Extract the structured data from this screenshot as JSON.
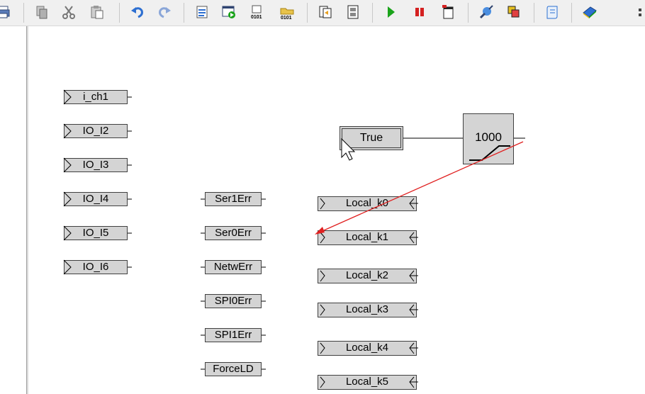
{
  "toolbar": {
    "icons": [
      "print-icon",
      "copy-icon",
      "cut-icon",
      "paste-icon",
      "undo-icon",
      "redo-icon",
      "document-list-icon",
      "window-go-icon",
      "compile-icon",
      "download-icon",
      "export-icon",
      "memory-icon",
      "run-icon",
      "stop-icon",
      "reset-icon",
      "connect-icon",
      "windows-icon",
      "script-icon",
      "book-icon",
      "more-icon"
    ],
    "colors": {
      "run": "#1aa31a",
      "stop": "#d42020",
      "accent_blue": "#2d6fd1"
    }
  },
  "diagram": {
    "inputs": [
      "i_ch1",
      "IO_I2",
      "IO_I3",
      "IO_I4",
      "IO_I5",
      "IO_I6"
    ],
    "errors": [
      "Ser1Err",
      "Ser0Err",
      "NetwErr",
      "SPI0Err",
      "SPI1Err",
      "ForceLD"
    ],
    "locals": [
      "Local_k0",
      "Local_k1",
      "Local_k2",
      "Local_k3",
      "Local_k4",
      "Local_k5"
    ],
    "constant": "True",
    "timer": "1000",
    "colors": {
      "block_fill": "#d4d4d4",
      "arrow": "#e02020"
    }
  }
}
